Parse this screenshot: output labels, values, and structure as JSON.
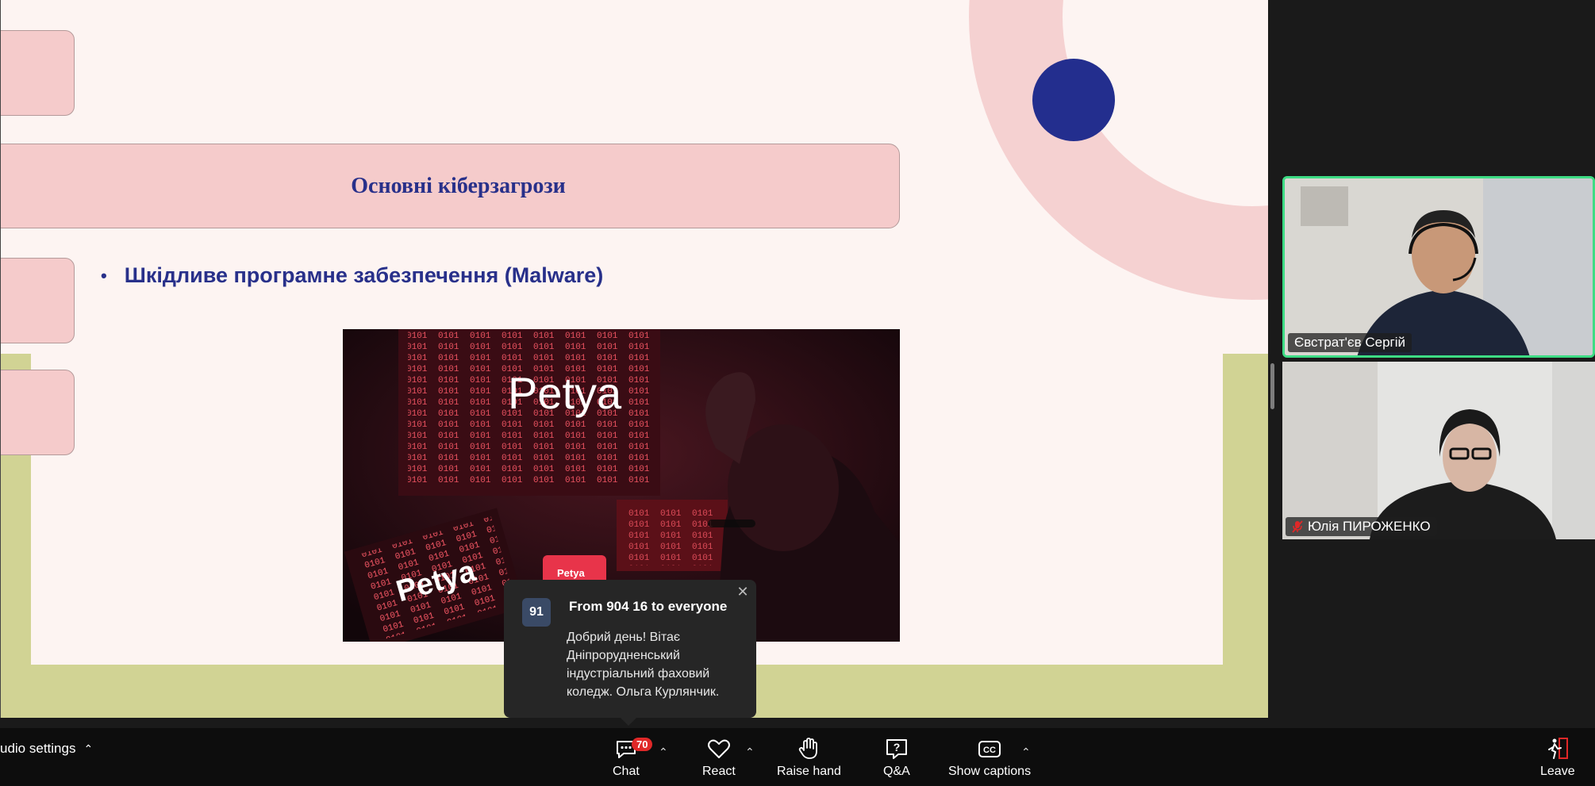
{
  "slide": {
    "title": "Основні кіберзагрози",
    "bullet": "Шкідливе програмне забезпечення (Malware)",
    "image_words": [
      "Petya",
      "Petya",
      "Petya"
    ]
  },
  "participants": [
    {
      "name": "Євстрат'єв Сергій",
      "muted": false,
      "speaking": true
    },
    {
      "name": "Юлія ПИРОЖЕНКО",
      "muted": true,
      "speaking": false
    }
  ],
  "toast": {
    "count": "91",
    "from": "From 904 16 to everyone",
    "message": "Добрий день! Вітає Дніпрорудненський індустріальний фаховий коледж. Ольга Курлянчик."
  },
  "toolbar": {
    "audio_settings": "udio settings",
    "chat": "Chat",
    "chat_badge": "70",
    "react": "React",
    "raise_hand": "Raise hand",
    "qa": "Q&A",
    "captions": "Show captions",
    "leave": "Leave"
  },
  "colors": {
    "slide_bg": "#fdf4f2",
    "accent_pink": "#f5cbcb",
    "title_blue": "#28308a",
    "frame_green": "#d1d394",
    "speaking_border": "#3ddc84",
    "badge_red": "#e02828",
    "leave_red": "#e02828"
  }
}
